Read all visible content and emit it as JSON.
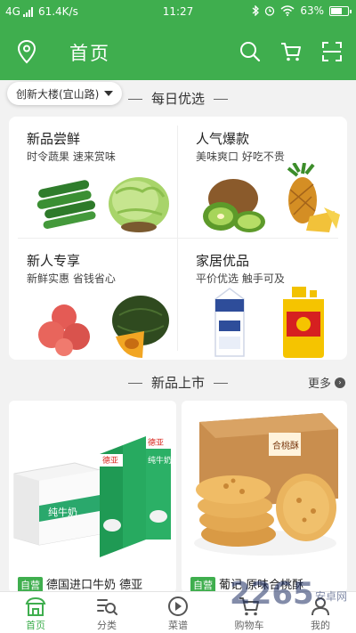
{
  "status_bar": {
    "network": "4G",
    "speed": "61.4K/s",
    "time": "11:27",
    "battery": "63%"
  },
  "header": {
    "title": "首页"
  },
  "location": {
    "label": "创新大楼(宜山路)"
  },
  "daily": {
    "title": "每日优选",
    "cards": [
      {
        "title": "新品尝鲜",
        "subtitle": "时令蔬果 速来赏味"
      },
      {
        "title": "人气爆款",
        "subtitle": "美味爽口 好吃不贵"
      },
      {
        "title": "新人专享",
        "subtitle": "新鲜实惠 省钱省心"
      },
      {
        "title": "家居优品",
        "subtitle": "平价优选 触手可及"
      }
    ]
  },
  "new_arrivals": {
    "title": "新品上市",
    "more": "更多",
    "products": [
      {
        "tag": "自营",
        "name": "德国进口牛奶 德亚",
        "box_brand": "德亚",
        "box_label": "纯牛奶"
      },
      {
        "tag": "自营",
        "name": "葡记 原味合桃酥",
        "box_label": "合桃酥"
      }
    ]
  },
  "tabbar": {
    "items": [
      {
        "label": "首页",
        "icon": "home-icon",
        "active": true
      },
      {
        "label": "分类",
        "icon": "category-icon",
        "active": false
      },
      {
        "label": "菜谱",
        "icon": "recipe-play-icon",
        "active": false
      },
      {
        "label": "购物车",
        "icon": "cart-icon",
        "active": false
      },
      {
        "label": "我的",
        "icon": "profile-icon",
        "active": false
      }
    ]
  },
  "watermark": {
    "text": "2265",
    "sub": "安卓网"
  },
  "colors": {
    "brand_green": "#3fae4e",
    "background": "#f2f2f2"
  }
}
